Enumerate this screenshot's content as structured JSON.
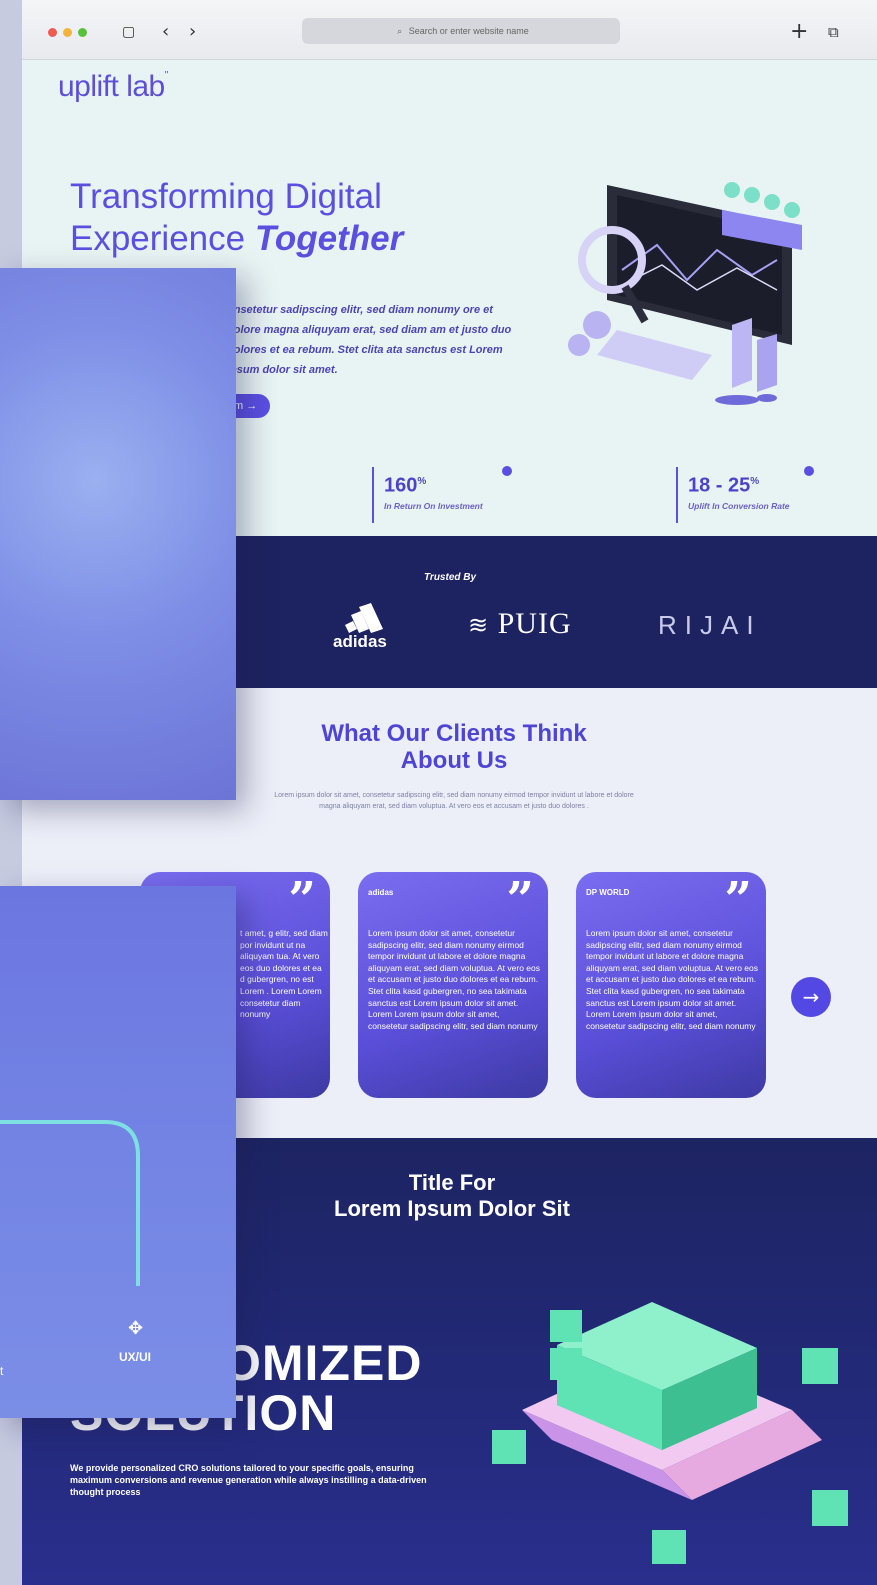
{
  "browser": {
    "address_placeholder": "Search or enter website name",
    "plus": "+",
    "back": "‹",
    "forward": "›"
  },
  "brand": {
    "name": "uplift lab",
    "mark": "\""
  },
  "hero": {
    "title_line1": "Transforming Digital",
    "title_line2_a": "Experience ",
    "title_line2_b": "Together",
    "paragraph": "onsetetur sadipscing elitr, sed diam nonumy ore et dolore magna aliquyam erat, sed diam am et justo duo dolores et ea rebum. Stet clita ata sanctus est Lorem ipsum dolor sit amet.",
    "button_label": "m →"
  },
  "stats": [
    {
      "value": "160",
      "unit": "%",
      "caption": "In Return On Investment"
    },
    {
      "value": "18 - 25",
      "unit": "%",
      "caption": "Uplift In Conversion Rate"
    }
  ],
  "trusted": {
    "label": "Trusted By",
    "logos": [
      "adidas",
      "PUIG",
      "RIJAI"
    ],
    "puig_symbol": "≋"
  },
  "testimonials": {
    "title_line1": "What Our Clients Think",
    "title_line2": "About Us",
    "intro": "Lorem ipsum dolor sit amet, consetetur sadipscing elitr, sed diam nonumy eirmod tempor invidunt ut labore et dolore magna aliquyam erat, sed diam voluptua. At vero eos et accusam et justo duo dolores .",
    "cards": [
      {
        "brand": "",
        "quote": "”",
        "text": "t amet, g elitr, sed diam por invidunt ut na aliquyam tua. At vero eos duo dolores et ea d gubergren, no est Lorem . Lorem Lorem consetetur diam nonumy"
      },
      {
        "brand": "adidas",
        "quote": "”",
        "text": "Lorem ipsum dolor sit amet, consetetur sadipscing elitr, sed diam nonumy eirmod tempor invidunt ut labore et dolore magna aliquyam erat, sed diam voluptua. At vero eos et accusam et justo duo dolores et ea rebum. Stet clita kasd gubergren, no sea takimata sanctus est Lorem ipsum dolor sit amet. Lorem Lorem ipsum dolor sit amet, consetetur sadipscing elitr, sed diam nonumy"
      },
      {
        "brand": "DP WORLD",
        "quote": "”",
        "text": "Lorem ipsum dolor sit amet, consetetur sadipscing elitr, sed diam nonumy eirmod tempor invidunt ut labore et dolore magna aliquyam erat, sed diam voluptua. At vero eos et accusam et justo duo dolores et ea rebum. Stet clita kasd gubergren, no sea takimata sanctus est Lorem ipsum dolor sit amet. Lorem Lorem ipsum dolor sit amet, consetetur sadipscing elitr, sed diam nonumy"
      }
    ],
    "next": "→"
  },
  "solutions": {
    "title_line1": "Title For",
    "title_line2": "Lorem Ipsum Dolor Sit",
    "big_line1": "OMIZED",
    "big_line2": "SOLUTION",
    "paragraph": "We provide personalized CRO solutions tailored to your specific goals, ensuring maximum conversions and revenue generation while always instilling a data-driven thought process"
  },
  "overlay": {
    "uxui_label": "UX/UI",
    "edge_text": "t"
  },
  "colors": {
    "accent": "#5a4fe2",
    "navy": "#1d2360",
    "mint": "#e8f3f3",
    "cube": "#5fe3b5"
  }
}
